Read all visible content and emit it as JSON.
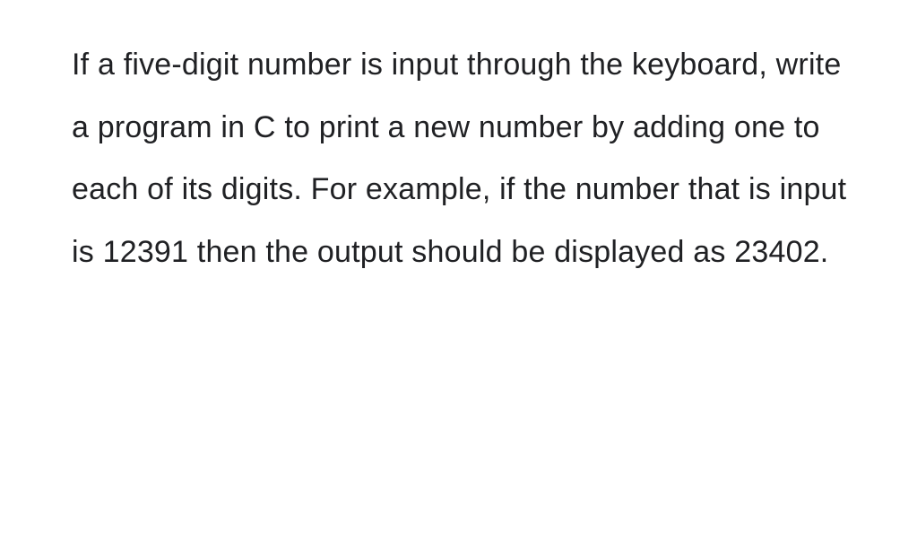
{
  "problem": {
    "statement": "If a five-digit number is input through the keyboard, write a program in C to print a new number by adding one to each of its digits. For example, if the number that is input is 12391 then the output should be displayed as 23402."
  }
}
